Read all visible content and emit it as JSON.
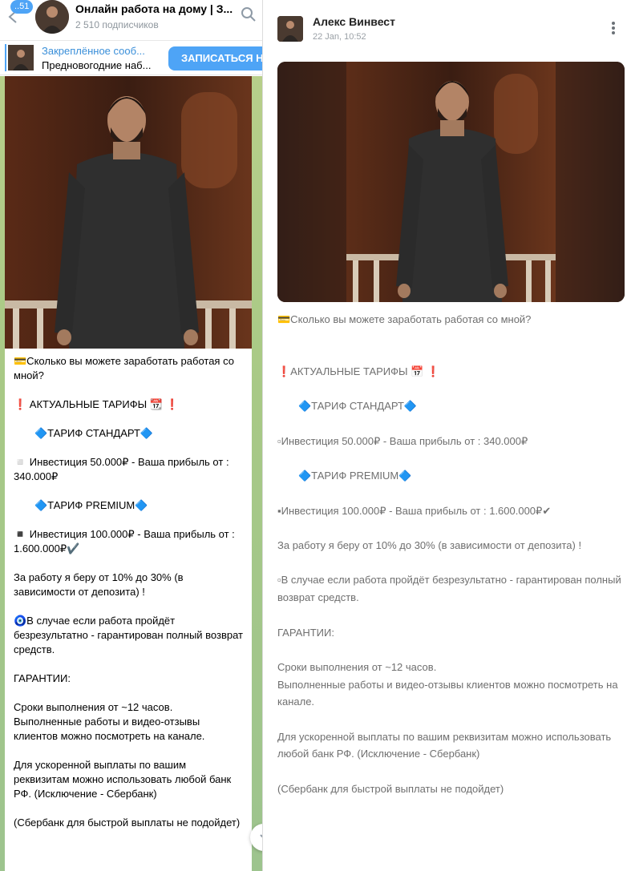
{
  "chat_header": {
    "unread_count": "..51",
    "channel_title": "Онлайн работа на дому | З...",
    "subscribers": "2 510 подписчиков"
  },
  "pinned": {
    "title": "Закреплённое сооб...",
    "text": "Предновогодние наб...",
    "subscribe_label": "ЗАПИСАТЬСЯ НА"
  },
  "message": {
    "lines": [
      "💳Сколько вы можете заработать работая со мной?",
      "",
      "❗️ АКТУАЛЬНЫЕ ТАРИФЫ 📆 ❗️",
      "",
      "🔷ТАРИФ СТАНДАРТ🔷",
      "",
      "◽️ Инвестиция 50.000₽ - Ваша прибыль от : 340.000₽",
      "",
      "🔷ТАРИФ PREMIUM🔷",
      "",
      "◾️ Инвестиция 100.000₽ - Ваша прибыль от : 1.600.000₽✔️",
      "",
      "За работу я беру от 10% до 30% (в зависимости  от  депозита)  !",
      "",
      "🧿В случае если работа пройдёт безрезультатно - гарантирован полный возврат средств.",
      "",
      "ГАРАНТИИ:",
      "",
      "Сроки выполнения от ~12 часов.",
      "Выполненные работы и видео-отзывы клиентов можно посмотреть на канале.",
      "",
      "Для ускоренной выплаты по вашим реквизитам можно использовать любой банк РФ.  (Исключение - Сбербанк)",
      "",
      "(Сбербанк для быстрой выплаты не подойдет)"
    ]
  },
  "post": {
    "author": "Алекс Винвест",
    "date": "22 Jan, 10:52",
    "lines": [
      "💳Сколько вы можете заработать работая со мной?",
      "",
      "",
      "❗АКТУАЛЬНЫЕ ТАРИФЫ 📅 ❗",
      "",
      "🔷ТАРИФ СТАНДАРТ🔷",
      "",
      "▫Инвестиция 50.000₽ - Ваша прибыль от : 340.000₽",
      "",
      "🔷ТАРИФ PREMIUM🔷",
      "",
      "▪Инвестиция 100.000₽ - Ваша прибыль от : 1.600.000₽✔",
      "",
      "За работу я беру от 10% до 30% (в зависимости  от  депозита)  !",
      "",
      "▫В случае если работа пройдёт безрезультатно - гарантирован полный возврат средств.",
      "",
      "ГАРАНТИИ:",
      "",
      "Сроки выполнения от ~12 часов.",
      "Выполненные работы и видео-отзывы клиентов можно посмотреть на канале.",
      "",
      "Для ускоренной выплаты по вашим реквизитам можно использовать любой банк РФ. (Исключение - Сбербанк)",
      "",
      "(Сбербанк для быстрой выплаты не подойдет)"
    ]
  },
  "colors": {
    "accent": "#4ea4f6",
    "pinned_title": "#3a8fd9",
    "chat_background": "#a8c986",
    "post_text": "#6f6f6f"
  },
  "icons": {
    "back": "arrow-left-icon",
    "search": "search-icon",
    "more": "more-vertical-icon",
    "scroll": "chevron-down-icon"
  }
}
